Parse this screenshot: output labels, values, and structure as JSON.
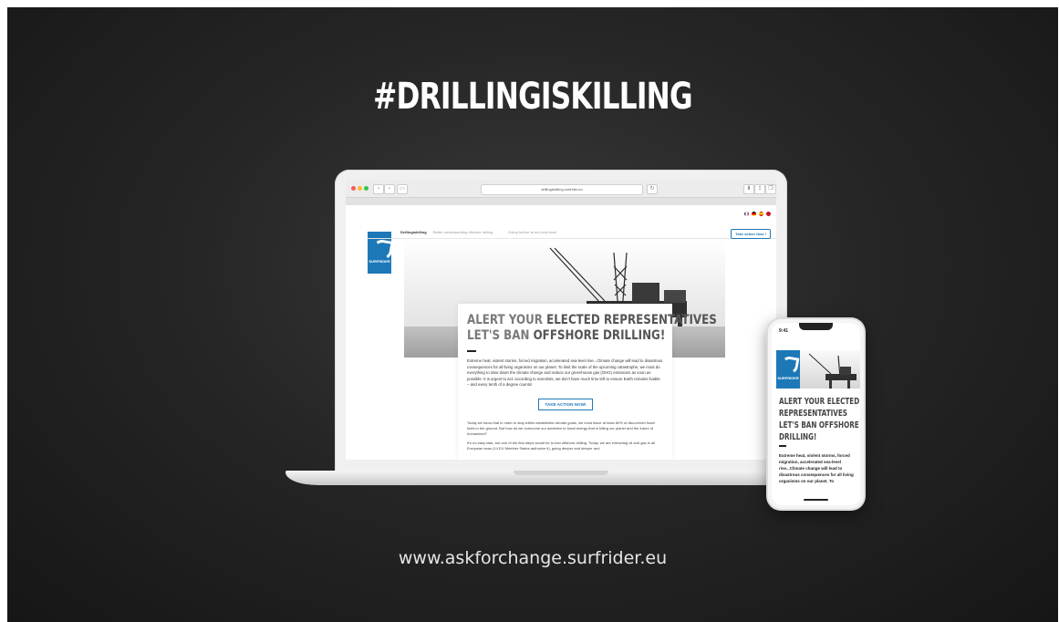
{
  "headline": "#DRILLINGISKILLING",
  "footer_url": "www.askforchange.surfrider.eu",
  "browser": {
    "address": "drillingiskilling.surfrider.eu"
  },
  "site": {
    "logo_text": "SURFRIDER",
    "nav": [
      {
        "label": "Drillingiskilling"
      },
      {
        "label": "Better understanding offshore drilling"
      },
      {
        "label": "Going further at my local level"
      }
    ],
    "cta_top": "Take action Now !",
    "title_line1_light": "ALERT YOUR ",
    "title_line1_bold": "ELECTED REPRESENTATIVES",
    "title_line2_light": "LET'S BAN ",
    "title_line2_bold": "OFFSHORE DRILLING!",
    "body": "Extreme heat, violent storms, forced migration, accelerated sea-level rise...Climate change will lead to disastrous consequences for all living organisms on our planet. To limit the scale of the upcoming catastrophe, we must do everything to slow down the climate change and reduce our greenhouse gas (GHG) emissions as soon as possible. It is urgent to act: according to scientists, we don't have much time left to ensure Earth remains livable – and every tenth of a degree counts!",
    "cta_main": "TAKE ACTION NOW!",
    "para2": "Today we know that in order to stay within established climate goals, we must leave at least 80% of discovered fossil fuels in the ground. But how do we overcome our addiction to fossil energy that is killing our planet and the future of humankind?",
    "para3": "It's no easy task, but one of the first steps would be to ban offshore drilling. Today, we are extracting oil and gas in all European seas (14 EU Member States authorize it), going deeper and deeper and"
  },
  "phone": {
    "time": "9:41",
    "logo_text": "SURFRIDER",
    "title_lines": [
      "ALERT YOUR ELECTED",
      "REPRESENTATIVES",
      "LET'S BAN OFFSHORE",
      "DRILLING!"
    ],
    "body": "Extreme heat, violent storms, forced migration, accelerated sea-level rise...Climate change will lead to disastrous consequences for all living organisms on our planet. To"
  },
  "colors": {
    "brand_blue": "#1d78b8",
    "background": "#262626"
  }
}
